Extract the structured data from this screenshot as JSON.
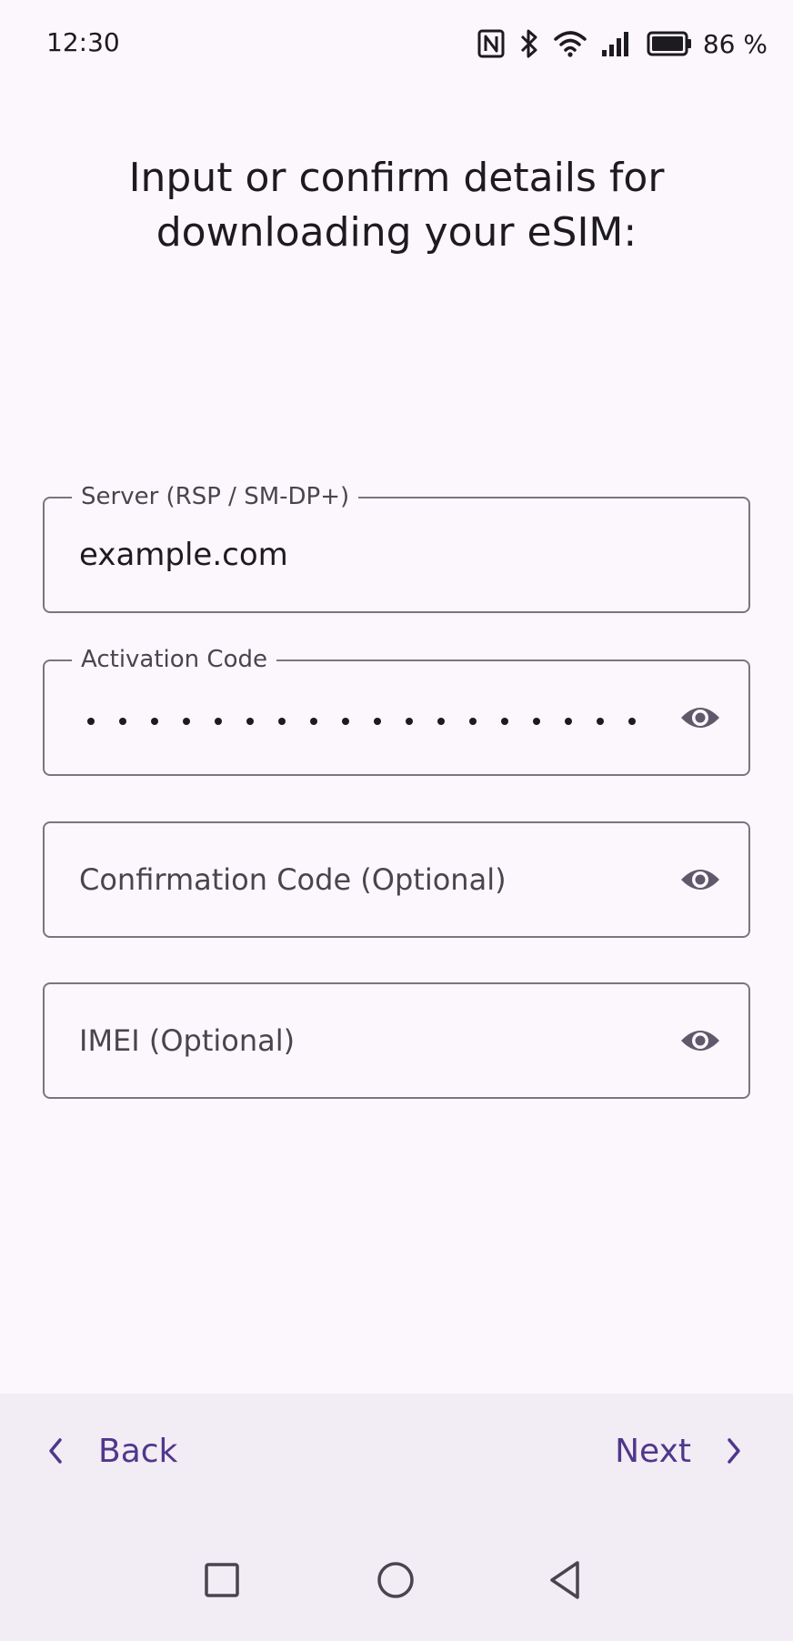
{
  "status_bar": {
    "time": "12:30",
    "battery_percent": "86 %",
    "icons": [
      "nfc-icon",
      "bluetooth-icon",
      "wifi-icon",
      "cell-signal-icon",
      "battery-icon"
    ]
  },
  "title": "Input or confirm details for downloading your eSIM:",
  "fields": {
    "server": {
      "label": "Server (RSP / SM-DP+)",
      "value": "example.com"
    },
    "activation_code": {
      "label": "Activation Code",
      "masked_length": 18
    },
    "confirmation_code": {
      "placeholder": "Confirmation Code (Optional)"
    },
    "imei": {
      "placeholder": "IMEI (Optional)"
    }
  },
  "nav": {
    "back_label": "Back",
    "next_label": "Next"
  },
  "colors": {
    "background": "#fcf7fc",
    "bottom_bar": "#f2ecf5",
    "accent": "#4f378b",
    "outline": "#7a757f"
  }
}
